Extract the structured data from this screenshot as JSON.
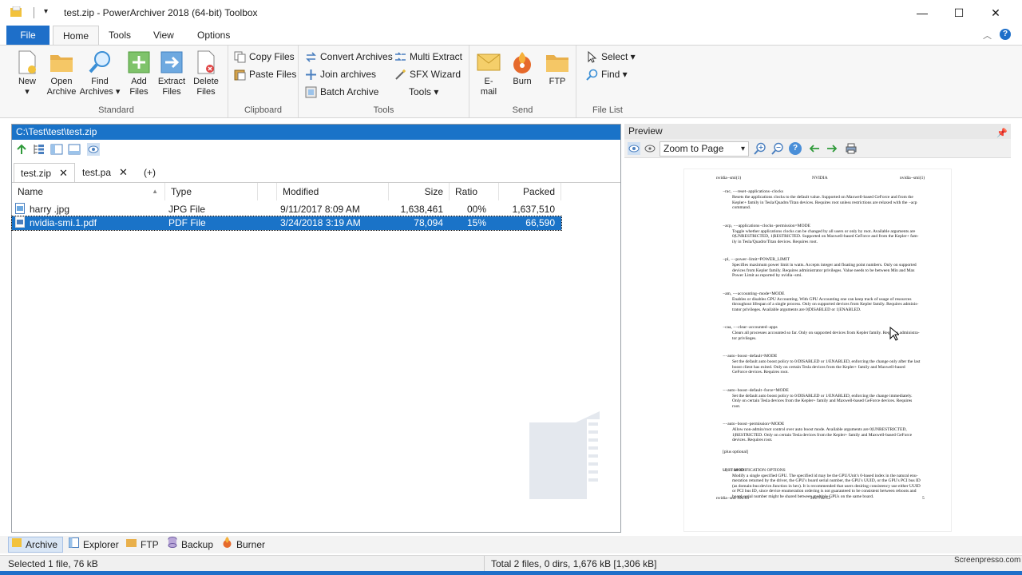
{
  "window": {
    "title": "test.zip - PowerArchiver 2018 (64-bit) Toolbox",
    "controls": {
      "minimize": "—",
      "maximize": "☐",
      "close": "✕"
    }
  },
  "ribbon_tabs": [
    "File",
    "Home",
    "Tools",
    "View",
    "Options"
  ],
  "ribbon": {
    "standard": {
      "label": "Standard",
      "buttons": [
        {
          "line1": "New",
          "line2": "▾"
        },
        {
          "line1": "Open",
          "line2": "Archive"
        },
        {
          "line1": "Find",
          "line2": "Archives ▾"
        },
        {
          "line1": "Add",
          "line2": "Files"
        },
        {
          "line1": "Extract",
          "line2": "Files"
        },
        {
          "line1": "Delete",
          "line2": "Files"
        }
      ]
    },
    "clipboard": {
      "label": "Clipboard",
      "copy": "Copy Files",
      "paste": "Paste Files"
    },
    "tools": {
      "label": "Tools",
      "convert": "Convert Archives",
      "join": "Join archives",
      "batch": "Batch Archive",
      "multi": "Multi Extract",
      "sfx": "SFX Wizard",
      "tools_dropdown": "Tools ▾"
    },
    "send": {
      "label": "Send",
      "email_line1": "E-",
      "email_line2": "mail",
      "burn": "Burn",
      "ftp": "FTP"
    },
    "filelist": {
      "label": "File List",
      "select": "Select ▾",
      "find": "Find ▾"
    }
  },
  "path": "C:\\Test\\test\\test.zip",
  "doc_tabs": [
    {
      "label": "test.zip",
      "close": "✕"
    },
    {
      "label": "test.pa",
      "close": "✕"
    },
    {
      "label": "(+)"
    }
  ],
  "columns": [
    "Name",
    "Type",
    "Modified",
    "Size",
    "Ratio",
    "Packed"
  ],
  "files": [
    {
      "name": "harry .jpg",
      "type": "JPG File",
      "modified": "9/11/2017 8:09 AM",
      "size": "1,638,461",
      "ratio": "00%",
      "packed": "1,637,510",
      "selected": false
    },
    {
      "name": "nvidia-smi.1.pdf",
      "type": "PDF File",
      "modified": "3/24/2018 3:19 AM",
      "size": "78,094",
      "ratio": "15%",
      "packed": "66,590",
      "selected": true
    }
  ],
  "preview": {
    "title": "Preview",
    "zoom": "Zoom to Page",
    "page": {
      "header_left": "nvidia−smi(1)",
      "header_center": "NVIDIA",
      "header_right": "nvidia−smi(1)",
      "sections": [
        {
          "head": "−rac, −−reset−applications−clocks",
          "lines": [
            "Resets the applications clocks to the default value.  Supported on Maxwell-based GeForce and from the",
            "Kepler+ family in Tesla/Quadro/Titan devices.  Requires root unless restrictions are relaxed with the −acp",
            "command."
          ]
        },
        {
          "head": "−acp, −−applications−clocks−permission=MODE",
          "lines": [
            "Toggle whether applications clocks can be changed by all users or only by root.  Available arguments are",
            "0|UNRESTRICTED, 1|RESTRICTED.  Supported on Maxwell-based GeForce and from the Kepler+ fam-",
            "ily in Tesla/Quadro/Titan devices.  Requires root."
          ]
        },
        {
          "head": "−pl, −−power−limit=POWER_LIMIT",
          "lines": [
            "Specifies maximum power limit in watts.  Accepts integer and floating point numbers.  Only on supported",
            "devices from Kepler family.  Requires administrator privileges.  Value needs to be between Min and Max",
            "Power Limit as reported by nvidia−smi."
          ]
        },
        {
          "head": "−am, −−accounting−mode=MODE",
          "lines": [
            "Enables or disables GPU Accounting.  With GPU Accounting one can keep track of usage of resources",
            "throughout lifespan of a single process.  Only on supported devices from Kepler family.  Requires adminis-",
            "trator privileges.  Available arguments are 0|DISABLED or 1|ENABLED."
          ]
        },
        {
          "head": "−caa, −−clear−accounted−apps",
          "lines": [
            "Clears all processes accounted so far.  Only on supported devices from Kepler family.  Requires administra-",
            "tor privileges."
          ]
        },
        {
          "head": "−−auto−boost−default=MODE",
          "lines": [
            "Set the default auto boost policy to 0/DISABLED or 1/ENABLED, enforcing the change only after the last",
            "boost client has exited.  Only on certain Tesla devices from the Kepler+ family and Maxwell-based",
            "GeForce devices.  Requires root."
          ]
        },
        {
          "head": "−−auto−boost−default−force=MODE",
          "lines": [
            "Set the default auto boost policy to 0/DISABLED or 1/ENABLED, enforcing the change immediately.",
            "Only on certain Tesla devices from the Kepler+ family and Maxwell-based GeForce devices.  Requires",
            "root."
          ]
        },
        {
          "head": "−−auto−boost−permission=MODE",
          "lines": [
            "Allow non-admin/root control over auto boost mode.  Available arguments are 0|UNRESTRICTED,",
            "1|RESTRICTED.  Only on certain Tesla devices from the Kepler+ family and Maxwell-based GeForce",
            "devices.  Requires root."
          ]
        },
        {
          "head": "[plus optional]",
          "lines": []
        },
        {
          "head": "−i, −−id=ID",
          "lines": [
            "Modify a single specified GPU.  The specified id may be the GPU/Unit's 0-based index in the natural enu-",
            "meration returned by the driver, the GPU's board serial number, the GPU's UUID, or the GPU's PCI bus ID",
            "(as domain:bus:device.function in hex).  It is recommended that users desiring consistency use either UUID",
            "or PCI bus ID, since device enumeration ordering is not guaranteed to be consistent between reboots and",
            "board serial number might be shared between multiple GPUs on the same board."
          ]
        }
      ],
      "subhead": "UNIT MODIFICATION OPTIONS",
      "footer_left": "nvidia−smi 390.09",
      "footer_center": "2017/12/12",
      "footer_right": "5"
    }
  },
  "bottom_tabs": [
    "Archive",
    "Explorer",
    "FTP",
    "Backup",
    "Burner"
  ],
  "status": {
    "left": "Selected 1 file, 76 kB",
    "right": "Total 2 files, 0 dirs, 1,676 kB [1,306 kB]"
  },
  "watermark": "Screenpresso.com",
  "colors": {
    "accent": "#1a73c8",
    "file_tab": "#1e6fc9"
  }
}
